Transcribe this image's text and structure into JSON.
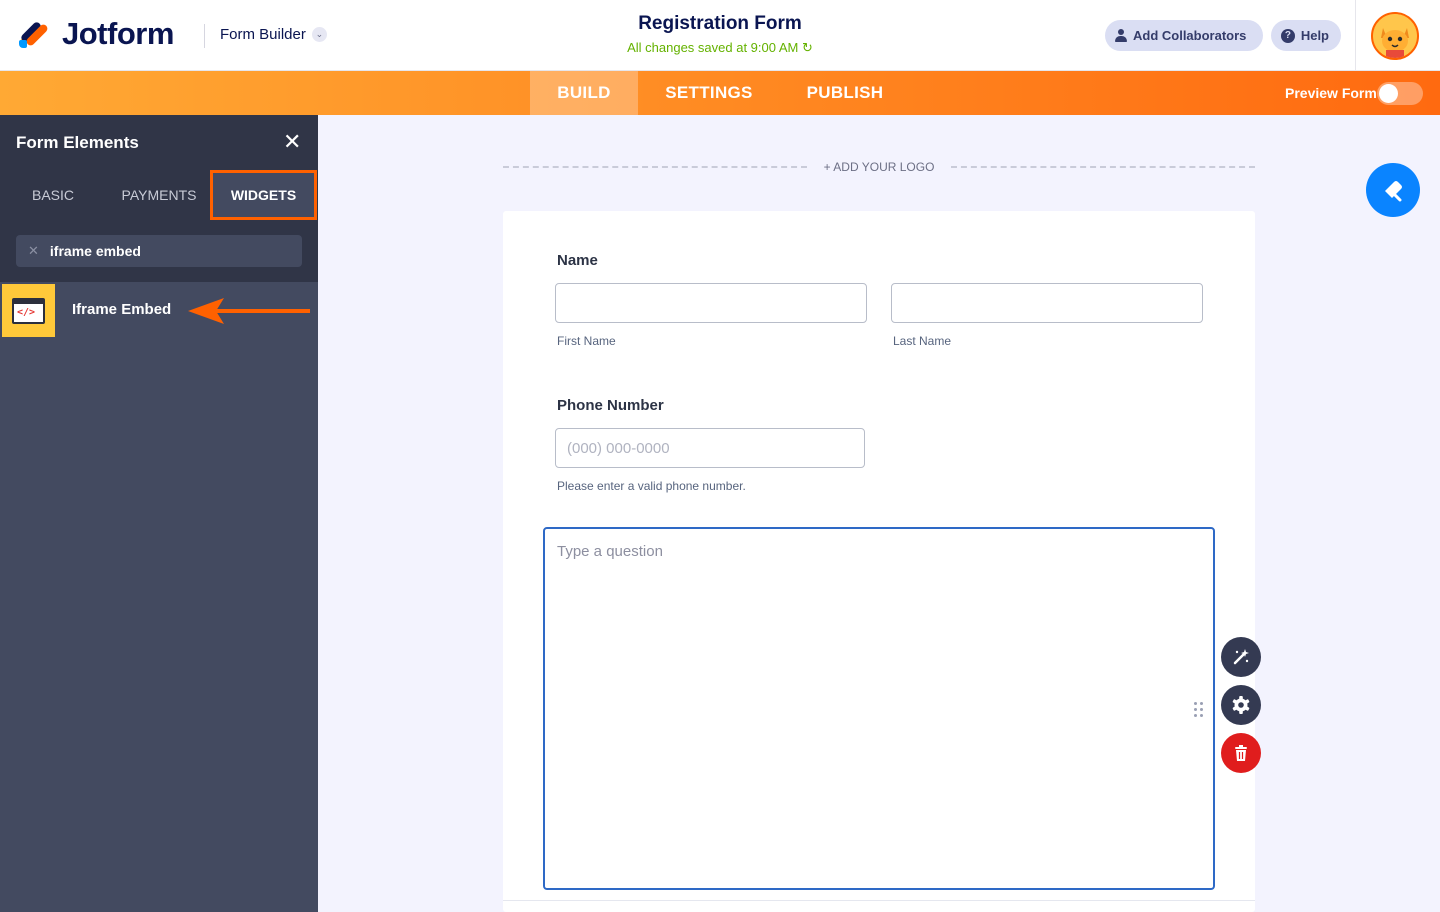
{
  "app": {
    "brand": "Jotform",
    "mode_selector": "Form Builder"
  },
  "header": {
    "form_title": "Registration Form",
    "save_status": "All changes saved at 9:00 AM",
    "add_collaborators": "Add Collaborators",
    "help": "Help"
  },
  "nav": {
    "tabs": [
      {
        "label": "BUILD",
        "active": true
      },
      {
        "label": "SETTINGS",
        "active": false
      },
      {
        "label": "PUBLISH",
        "active": false
      }
    ],
    "preview_label": "Preview Form",
    "preview_on": false
  },
  "sidebar": {
    "title": "Form Elements",
    "tabs": [
      {
        "label": "BASIC",
        "active": false
      },
      {
        "label": "PAYMENTS",
        "active": false
      },
      {
        "label": "WIDGETS",
        "active": true
      }
    ],
    "search_value": "iframe embed",
    "results": [
      {
        "label": "Iframe Embed",
        "icon": "code-window-icon"
      }
    ]
  },
  "canvas": {
    "add_logo": "+ ADD YOUR LOGO",
    "fields": {
      "name": {
        "label": "Name",
        "first_sub": "First Name",
        "last_sub": "Last Name"
      },
      "phone": {
        "label": "Phone Number",
        "placeholder": "(000) 000-0000",
        "hint": "Please enter a valid phone number."
      },
      "question": {
        "placeholder": "Type a question"
      }
    }
  },
  "colors": {
    "accent": "#ff6100",
    "brand_navy": "#0a1551",
    "selection_blue": "#2e69c6",
    "delete_red": "#e01d1d"
  }
}
